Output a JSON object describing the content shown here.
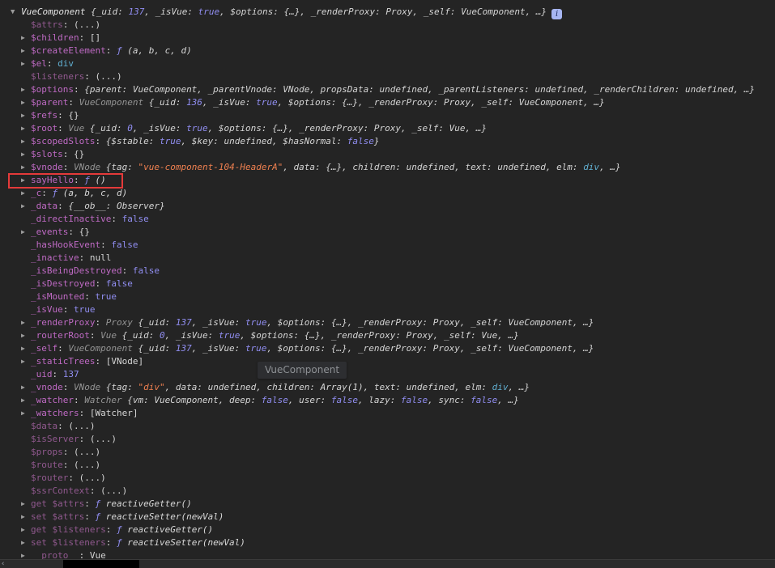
{
  "console": {
    "tooltip_text": "VueComponent",
    "info_badge_glyph": "i",
    "prompt_remnant_glyph": "‹",
    "accent_colors": {
      "background": "#242424",
      "property_key": "#bf6ac4",
      "property_key_dim": "#91598f",
      "number_boolean": "#918ef2",
      "string": "#ef8050",
      "dom_node": "#61afd1",
      "highlight_border": "#e43a3a"
    },
    "rows": [
      {
        "top": true,
        "arrow": "down",
        "info": true,
        "segs": [
          [
            "obj",
            "VueComponent"
          ],
          [
            "pv",
            " {_uid: "
          ],
          [
            "num i",
            "137"
          ],
          [
            "pv",
            ", _isVue: "
          ],
          [
            "num i",
            "true"
          ],
          [
            "pv",
            ", $options: {…}, _renderProxy: Proxy, _self: VueComponent, …}"
          ]
        ]
      },
      {
        "key": "$attrs",
        "dim": true,
        "evalLink": true,
        "segs": [
          [
            "plain",
            "(...)"
          ]
        ]
      },
      {
        "key": "$children",
        "arrow": true,
        "segs": [
          [
            "plain",
            "[]"
          ]
        ]
      },
      {
        "key": "$createElement",
        "arrow": true,
        "segs": [
          [
            "fn",
            "ƒ "
          ],
          [
            "sig",
            "(a, b, c, d)"
          ]
        ]
      },
      {
        "key": "$el",
        "arrow": true,
        "segs": [
          [
            "node",
            "div"
          ]
        ]
      },
      {
        "key": "$listeners",
        "dim": true,
        "evalLink": true,
        "segs": [
          [
            "plain",
            "(...)"
          ]
        ]
      },
      {
        "key": "$options",
        "arrow": true,
        "segs": [
          [
            "pv",
            "{parent: VueComponent, _parentVnode: VNode, propsData: undefined, _parentListeners: undefined, _renderChildren: undefined, …}"
          ]
        ]
      },
      {
        "key": "$parent",
        "arrow": true,
        "segs": [
          [
            "cls",
            "VueComponent "
          ],
          [
            "pv",
            "{_uid: "
          ],
          [
            "num i",
            "136"
          ],
          [
            "pv",
            ", _isVue: "
          ],
          [
            "num i",
            "true"
          ],
          [
            "pv",
            ", $options: {…}, _renderProxy: Proxy, _self: VueComponent, …}"
          ]
        ]
      },
      {
        "key": "$refs",
        "arrow": true,
        "segs": [
          [
            "plain",
            "{}"
          ]
        ]
      },
      {
        "key": "$root",
        "arrow": true,
        "segs": [
          [
            "cls",
            "Vue "
          ],
          [
            "pv",
            "{_uid: "
          ],
          [
            "num i",
            "0"
          ],
          [
            "pv",
            ", _isVue: "
          ],
          [
            "num i",
            "true"
          ],
          [
            "pv",
            ", $options: {…}, _renderProxy: Proxy, _self: Vue, …}"
          ]
        ]
      },
      {
        "key": "$scopedSlots",
        "arrow": true,
        "segs": [
          [
            "pv",
            "{$stable: "
          ],
          [
            "num i",
            "true"
          ],
          [
            "pv",
            ", $key: undefined, $hasNormal: "
          ],
          [
            "num i",
            "false"
          ],
          [
            "pv",
            "}"
          ]
        ]
      },
      {
        "key": "$slots",
        "arrow": true,
        "segs": [
          [
            "plain",
            "{}"
          ]
        ]
      },
      {
        "key": "$vnode",
        "arrow": true,
        "segs": [
          [
            "cls",
            "VNode "
          ],
          [
            "pv",
            "{tag: "
          ],
          [
            "str i",
            "\"vue-component-104-HeaderA\""
          ],
          [
            "pv",
            ", data: {…}, children: undefined, text: undefined, elm: "
          ],
          [
            "node i",
            "div"
          ],
          [
            "pv",
            ", …}"
          ]
        ]
      },
      {
        "key": "sayHello",
        "arrow": true,
        "highlight": true,
        "segs": [
          [
            "fn",
            "ƒ "
          ],
          [
            "sig",
            "()"
          ]
        ]
      },
      {
        "key": "_c",
        "arrow": true,
        "segs": [
          [
            "fn",
            "ƒ "
          ],
          [
            "sig",
            "(a, b, c, d)"
          ]
        ]
      },
      {
        "key": "_data",
        "arrow": true,
        "segs": [
          [
            "pv",
            "{__ob__: Observer}"
          ]
        ]
      },
      {
        "key": "_directInactive",
        "segs": [
          [
            "num",
            "false"
          ]
        ]
      },
      {
        "key": "_events",
        "arrow": true,
        "segs": [
          [
            "plain",
            "{}"
          ]
        ]
      },
      {
        "key": "_hasHookEvent",
        "segs": [
          [
            "num",
            "false"
          ]
        ]
      },
      {
        "key": "_inactive",
        "segs": [
          [
            "plain",
            "null"
          ]
        ]
      },
      {
        "key": "_isBeingDestroyed",
        "segs": [
          [
            "num",
            "false"
          ]
        ]
      },
      {
        "key": "_isDestroyed",
        "segs": [
          [
            "num",
            "false"
          ]
        ]
      },
      {
        "key": "_isMounted",
        "segs": [
          [
            "num",
            "true"
          ]
        ]
      },
      {
        "key": "_isVue",
        "segs": [
          [
            "num",
            "true"
          ]
        ]
      },
      {
        "key": "_renderProxy",
        "arrow": true,
        "segs": [
          [
            "cls",
            "Proxy "
          ],
          [
            "pv",
            "{_uid: "
          ],
          [
            "num i",
            "137"
          ],
          [
            "pv",
            ", _isVue: "
          ],
          [
            "num i",
            "true"
          ],
          [
            "pv",
            ", $options: {…}, _renderProxy: Proxy, _self: VueComponent, …}"
          ]
        ]
      },
      {
        "key": "_routerRoot",
        "arrow": true,
        "segs": [
          [
            "cls",
            "Vue "
          ],
          [
            "pv",
            "{_uid: "
          ],
          [
            "num i",
            "0"
          ],
          [
            "pv",
            ", _isVue: "
          ],
          [
            "num i",
            "true"
          ],
          [
            "pv",
            ", $options: {…}, _renderProxy: Proxy, _self: Vue, …}"
          ]
        ]
      },
      {
        "key": "_self",
        "arrow": true,
        "segs": [
          [
            "cls",
            "VueComponent "
          ],
          [
            "pv",
            "{_uid: "
          ],
          [
            "num i",
            "137"
          ],
          [
            "pv",
            ", _isVue: "
          ],
          [
            "num i",
            "true"
          ],
          [
            "pv",
            ", $options: {…}, _renderProxy: Proxy, _self: VueComponent, …}"
          ]
        ]
      },
      {
        "key": "_staticTrees",
        "arrow": true,
        "segs": [
          [
            "plain",
            "[VNode]"
          ]
        ]
      },
      {
        "key": "_uid",
        "segs": [
          [
            "num",
            "137"
          ]
        ]
      },
      {
        "key": "_vnode",
        "arrow": true,
        "segs": [
          [
            "cls",
            "VNode "
          ],
          [
            "pv",
            "{tag: "
          ],
          [
            "str i",
            "\"div\""
          ],
          [
            "pv",
            ", data: undefined, children: Array(1), text: undefined, elm: "
          ],
          [
            "node i",
            "div"
          ],
          [
            "pv",
            ", …}"
          ]
        ]
      },
      {
        "key": "_watcher",
        "arrow": true,
        "segs": [
          [
            "cls",
            "Watcher "
          ],
          [
            "pv",
            "{vm: VueComponent, deep: "
          ],
          [
            "num i",
            "false"
          ],
          [
            "pv",
            ", user: "
          ],
          [
            "num i",
            "false"
          ],
          [
            "pv",
            ", lazy: "
          ],
          [
            "num i",
            "false"
          ],
          [
            "pv",
            ", sync: "
          ],
          [
            "num i",
            "false"
          ],
          [
            "pv",
            ", …}"
          ]
        ]
      },
      {
        "key": "_watchers",
        "arrow": true,
        "segs": [
          [
            "plain",
            "[Watcher]"
          ]
        ]
      },
      {
        "key": "$data",
        "dim": true,
        "evalLink": true,
        "segs": [
          [
            "plain",
            "(...)"
          ]
        ]
      },
      {
        "key": "$isServer",
        "dim": true,
        "evalLink": true,
        "segs": [
          [
            "plain",
            "(...)"
          ]
        ]
      },
      {
        "key": "$props",
        "dim": true,
        "evalLink": true,
        "segs": [
          [
            "plain",
            "(...)"
          ]
        ]
      },
      {
        "key": "$route",
        "dim": true,
        "evalLink": true,
        "segs": [
          [
            "plain",
            "(...)"
          ]
        ]
      },
      {
        "key": "$router",
        "dim": true,
        "evalLink": true,
        "segs": [
          [
            "plain",
            "(...)"
          ]
        ]
      },
      {
        "key": "$ssrContext",
        "dim": true,
        "evalLink": true,
        "segs": [
          [
            "plain",
            "(...)"
          ]
        ]
      },
      {
        "key": "get $attrs",
        "dim": true,
        "arrow": true,
        "segs": [
          [
            "fn",
            "ƒ "
          ],
          [
            "sig",
            "reactiveGetter()"
          ]
        ]
      },
      {
        "key": "set $attrs",
        "dim": true,
        "arrow": true,
        "segs": [
          [
            "fn",
            "ƒ "
          ],
          [
            "sig",
            "reactiveSetter(newVal)"
          ]
        ]
      },
      {
        "key": "get $listeners",
        "dim": true,
        "arrow": true,
        "segs": [
          [
            "fn",
            "ƒ "
          ],
          [
            "sig",
            "reactiveGetter()"
          ]
        ]
      },
      {
        "key": "set $listeners",
        "dim": true,
        "arrow": true,
        "segs": [
          [
            "fn",
            "ƒ "
          ],
          [
            "sig",
            "reactiveSetter(newVal)"
          ]
        ]
      },
      {
        "key": "__proto__",
        "dim": true,
        "arrow": true,
        "segs": [
          [
            "plain",
            "Vue"
          ]
        ]
      }
    ]
  }
}
